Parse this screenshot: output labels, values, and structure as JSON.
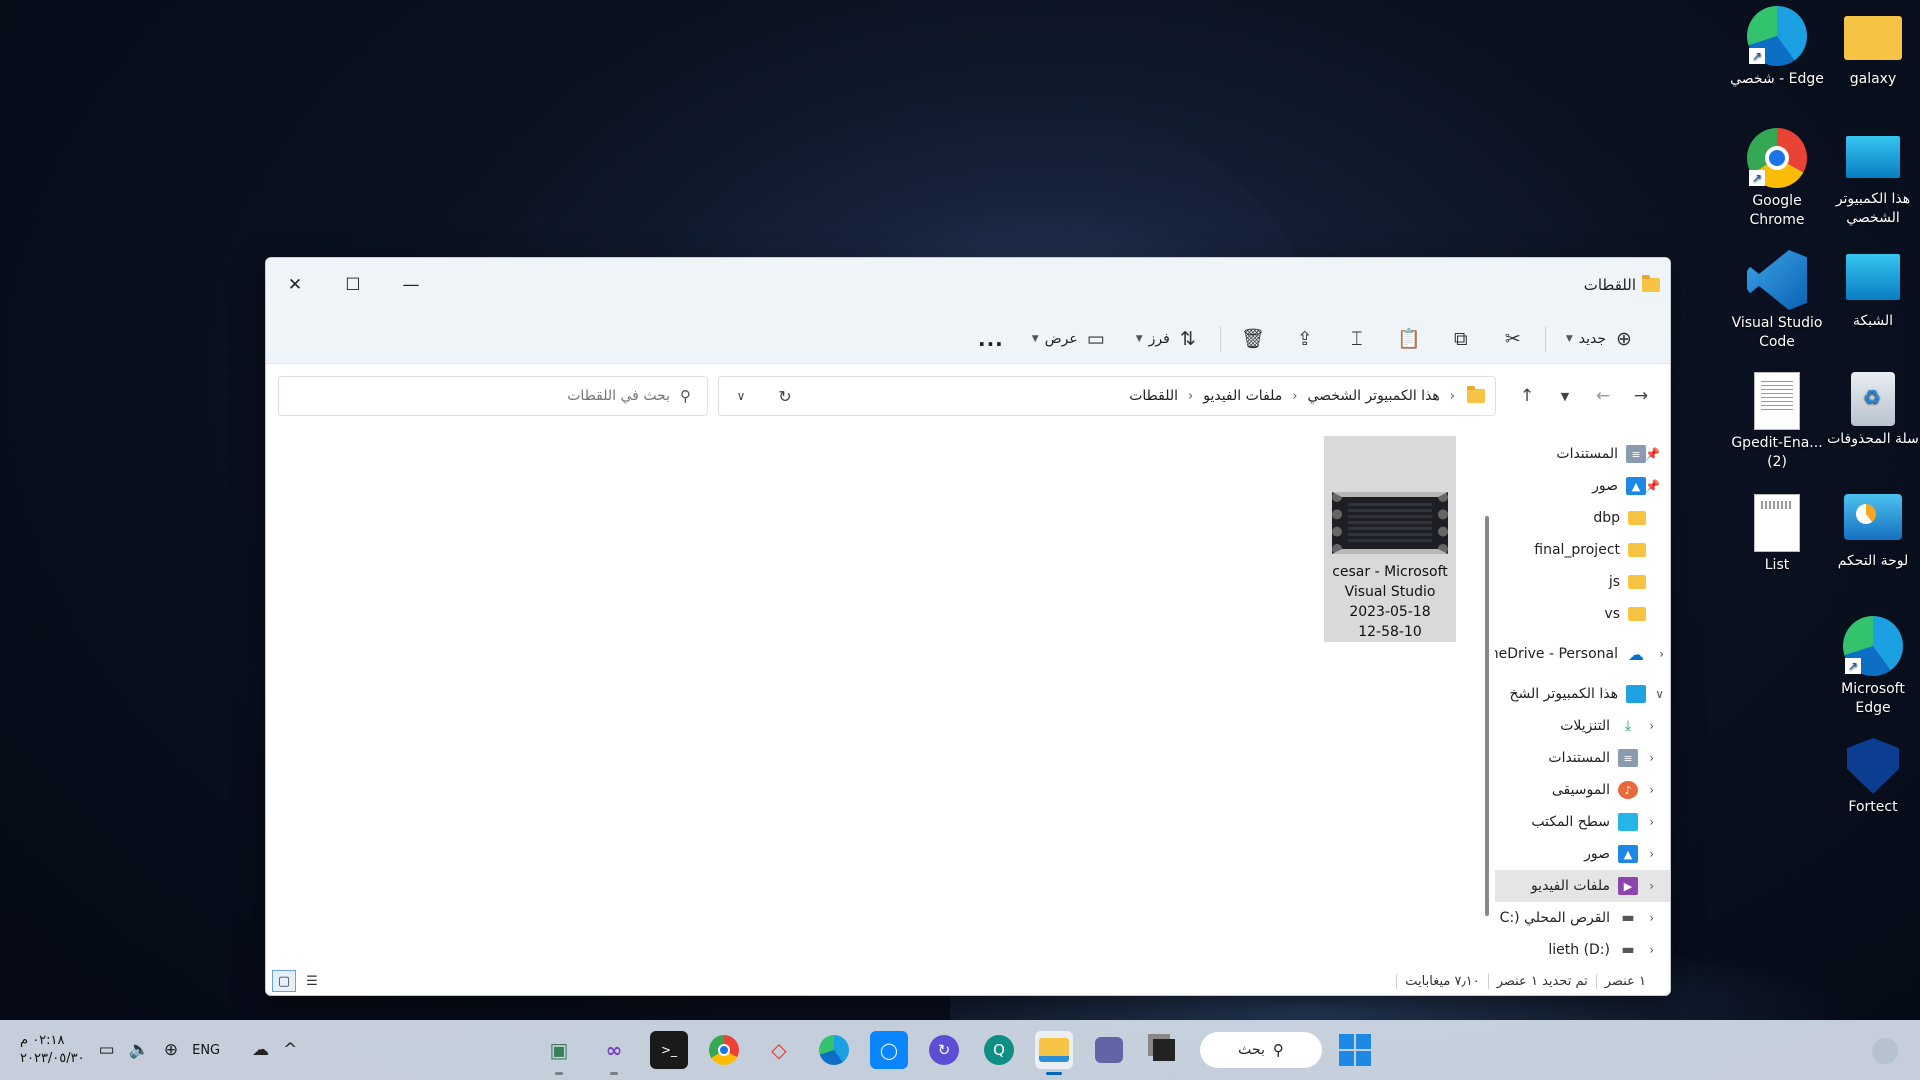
{
  "desktop": {
    "icons": [
      {
        "id": "galaxy",
        "label": "galaxy"
      },
      {
        "id": "edge-personal",
        "label": "شخصي - Edge"
      },
      {
        "id": "this-pc",
        "label": "هذا الكمبيوتر الشخصي"
      },
      {
        "id": "chrome",
        "label": "Google Chrome"
      },
      {
        "id": "network",
        "label": "الشبكة"
      },
      {
        "id": "vscode",
        "label": "Visual Studio Code"
      },
      {
        "id": "recycle",
        "label": "سلة المحذوفات"
      },
      {
        "id": "gpedit",
        "label": "Gpedit-Ena... (2)"
      },
      {
        "id": "control-panel",
        "label": "لوحة التحكم"
      },
      {
        "id": "list",
        "label": "List"
      },
      {
        "id": "edge",
        "label": "Microsoft Edge"
      },
      {
        "id": "fortect",
        "label": "Fortect"
      }
    ]
  },
  "window": {
    "title": "اللقطات",
    "toolbar": {
      "new_label": "جديد",
      "sort_label": "فرز",
      "view_label": "عرض",
      "more_label": "..."
    },
    "breadcrumb": [
      "هذا الكمبيوتر الشخصي",
      "ملفات الفيديو",
      "اللقطات"
    ],
    "search": {
      "placeholder": "بحث في اللقطات"
    },
    "files": [
      {
        "name_lines": [
          "cesar - Microsoft",
          "Visual Studio",
          "2023-05-18",
          "12-58-10"
        ]
      }
    ],
    "nav": {
      "quick_access": [
        {
          "label": "المستندات",
          "icon": "documents-icon",
          "pinned": true
        },
        {
          "label": "صور",
          "icon": "pictures-icon",
          "pinned": true
        },
        {
          "label": "dbp",
          "icon": "folder-icon"
        },
        {
          "label": "final_project",
          "icon": "folder-icon"
        },
        {
          "label": "js",
          "icon": "folder-icon"
        },
        {
          "label": "vs",
          "icon": "folder-icon"
        }
      ],
      "onedrive": "neDrive - Personal",
      "this_pc": "هذا الكمبيوتر الشخ",
      "this_pc_children": [
        {
          "label": "التنزيلات",
          "icon": "downloads-icon"
        },
        {
          "label": "المستندات",
          "icon": "documents-icon"
        },
        {
          "label": "الموسيقى",
          "icon": "music-icon"
        },
        {
          "label": "سطح المكتب",
          "icon": "desktop-icon"
        },
        {
          "label": "صور",
          "icon": "pictures-icon"
        },
        {
          "label": "ملفات الفيديو",
          "icon": "videos-icon",
          "selected": true
        },
        {
          "label": "القرص المحلي (:C",
          "icon": "drive-icon"
        },
        {
          "label": "lieth (D:)",
          "icon": "drive-icon"
        }
      ]
    },
    "status": {
      "count": "١ عنصر",
      "selection": "تم تحديد ١ عنصر",
      "size": "٧٫١٠ ميغابايت"
    }
  },
  "taskbar": {
    "time": "٠٢:١٨ م",
    "date": "٢٠٢٣/٠٥/٣٠",
    "language": "ENG",
    "search_label": "بحث"
  },
  "colors": {
    "accent": "#0067c0",
    "folder": "#f6c344",
    "window_chrome": "#eff4f9"
  }
}
